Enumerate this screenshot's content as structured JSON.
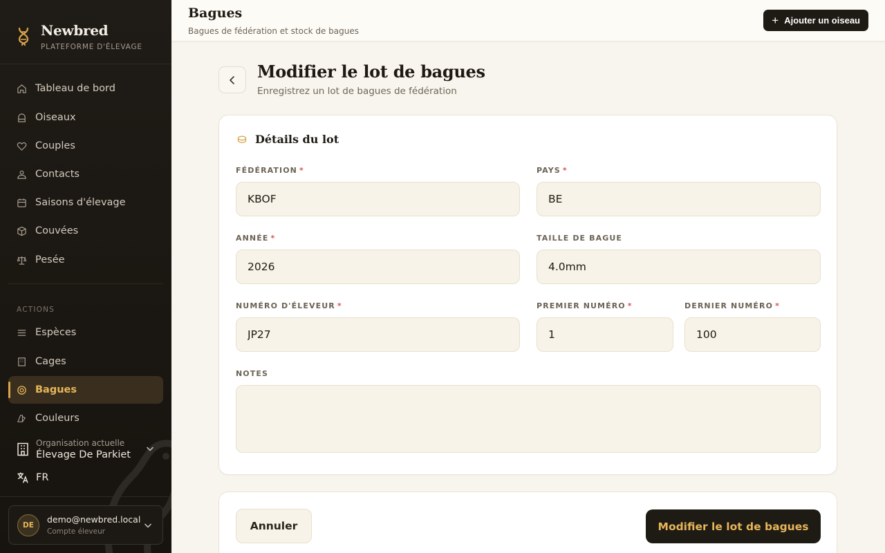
{
  "brand": {
    "name": "Newbred",
    "subtitle": "PLATEFORME D'ÉLEVAGE"
  },
  "sidebar": {
    "items": [
      {
        "label": "Tableau de bord",
        "icon": "home-icon"
      },
      {
        "label": "Oiseaux",
        "icon": "cage-icon"
      },
      {
        "label": "Couples",
        "icon": "heart-icon"
      },
      {
        "label": "Contacts",
        "icon": "contacts-icon"
      },
      {
        "label": "Saisons d'élevage",
        "icon": "calendar-icon"
      },
      {
        "label": "Couvées",
        "icon": "box-icon"
      },
      {
        "label": "Pesée",
        "icon": "scale-icon"
      }
    ],
    "section_label": "ACTIONS",
    "action_items": [
      {
        "label": "Espèces",
        "icon": "list-icon"
      },
      {
        "label": "Cages",
        "icon": "building-icon"
      },
      {
        "label": "Bagues",
        "icon": "ring-icon",
        "active": true
      },
      {
        "label": "Couleurs",
        "icon": "palette-icon"
      }
    ],
    "org": {
      "label": "Organisation actuelle",
      "name": "Élevage De Parkiet"
    },
    "language": "FR",
    "user": {
      "initials": "DE",
      "email": "demo@newbred.local",
      "role": "Compte éleveur"
    }
  },
  "header": {
    "title": "Bagues",
    "subtitle": "Bagues de fédération et stock de bagues",
    "add_button": "Ajouter un oiseau"
  },
  "page": {
    "title": "Modifier le lot de bagues",
    "subtitle": "Enregistrez un lot de bagues de fédération"
  },
  "card": {
    "title": "Détails du lot",
    "fields": {
      "federation": {
        "label": "FÉDÉRATION",
        "value": "KBOF",
        "required": "*"
      },
      "country": {
        "label": "PAYS",
        "value": "BE",
        "required": "*"
      },
      "year": {
        "label": "ANNÉE",
        "value": "2026",
        "required": "*"
      },
      "ring_size": {
        "label": "TAILLE DE BAGUE",
        "value": "4.0mm"
      },
      "breeder_number": {
        "label": "NUMÉRO D'ÉLEVEUR",
        "value": "JP27",
        "required": "*"
      },
      "first_number": {
        "label": "PREMIER NUMÉRO",
        "value": "1",
        "required": "*"
      },
      "last_number": {
        "label": "DERNIER NUMÉRO",
        "value": "100",
        "required": "*"
      },
      "notes": {
        "label": "NOTES",
        "value": ""
      }
    }
  },
  "actions": {
    "cancel": "Annuler",
    "submit": "Modifier le lot de bagues"
  },
  "colors": {
    "accent": "#e7b65a",
    "sidebar_bg": "#1f1b16",
    "required": "#d9534f"
  }
}
